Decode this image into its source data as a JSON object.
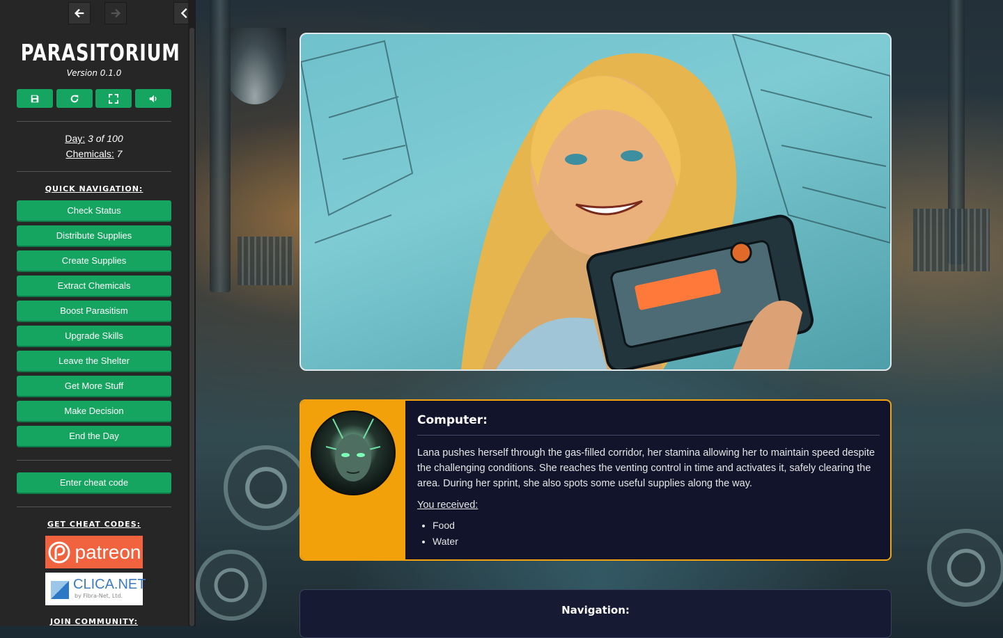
{
  "sidebar": {
    "nav": {
      "back_icon": "arrow-left-icon",
      "forward_icon": "arrow-right-icon",
      "collapse_icon": "chevron-left-icon"
    },
    "title": "PARASITORIUM",
    "version": "Version 0.1.0",
    "tools": [
      {
        "icon": "save-icon"
      },
      {
        "icon": "restart-icon"
      },
      {
        "icon": "fullscreen-icon"
      },
      {
        "icon": "volume-icon"
      }
    ],
    "stats": {
      "day_label": "Day:",
      "day_value": "3 of 100",
      "chemicals_label": "Chemicals:",
      "chemicals_value": "7"
    },
    "quick_nav_title": "QUICK NAVIGATION:",
    "menu": [
      "Check Status",
      "Distribute Supplies",
      "Create Supplies",
      "Extract Chemicals",
      "Boost Parasitism",
      "Upgrade Skills",
      "Leave the Shelter",
      "Get More Stuff",
      "Make Decision",
      "End the Day"
    ],
    "cheat_button": "Enter cheat code",
    "get_cheat_codes_title": "GET CHEAT CODES:",
    "patreon_label": "patreon",
    "clica_name": "CLICA.NET",
    "clica_by": "by Fibra-Net, Ltd.",
    "join_community_title": "JOIN COMMUNITY:"
  },
  "dialog": {
    "speaker": "Computer:",
    "text": "Lana pushes herself through the gas-filled corridor, her stamina allowing her to maintain speed despite the challenging conditions. She reaches the venting control in time and activates it, safely clearing the area. During her sprint, she also spots some useful supplies along the way.",
    "received_label": "You received:",
    "items": [
      "Food",
      "Water"
    ]
  },
  "navigation": {
    "title": "Navigation:"
  },
  "colors": {
    "accent_green": "#16a561",
    "dialog_orange": "#f3a10a",
    "dialog_bg": "#11142a",
    "sidebar_bg": "#262626"
  }
}
